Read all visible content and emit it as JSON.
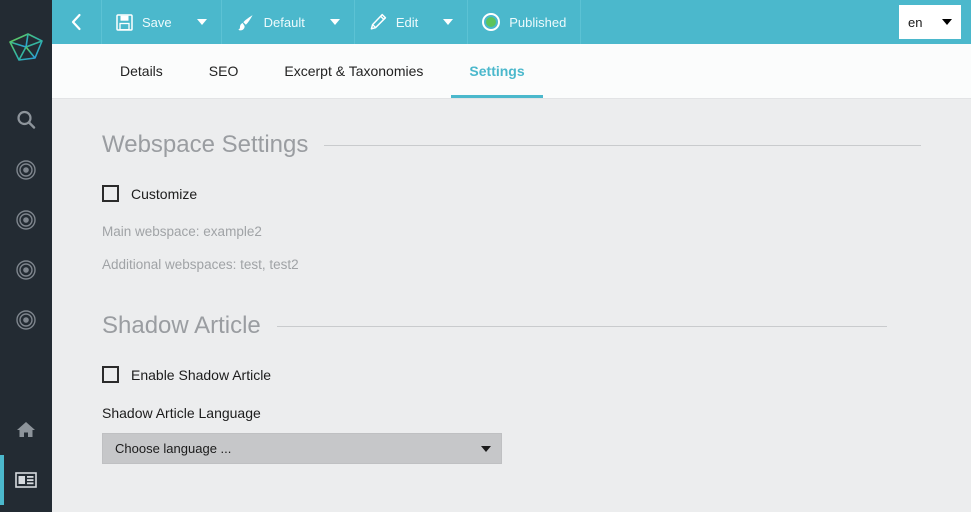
{
  "sidebar": {
    "logo_name": "gem-logo",
    "items": [
      {
        "name": "search-icon",
        "icon": "search",
        "active": false
      },
      {
        "name": "target-icon-1",
        "icon": "target",
        "active": false
      },
      {
        "name": "target-icon-2",
        "icon": "target",
        "active": false
      },
      {
        "name": "target-icon-3",
        "icon": "target",
        "active": false
      },
      {
        "name": "target-icon-4",
        "icon": "target",
        "active": false
      },
      {
        "name": "home-icon",
        "icon": "home",
        "active": false
      },
      {
        "name": "newspaper-icon",
        "icon": "newspaper",
        "active": true
      }
    ]
  },
  "toolbar": {
    "back_label": "",
    "back_icon": "chevron-left-icon",
    "save_label": "Save",
    "save_icon": "floppy-disk-icon",
    "default_label": "Default",
    "default_icon": "paintbrush-icon",
    "edit_label": "Edit",
    "edit_icon": "pencil-icon",
    "status_label": "Published",
    "status_icon": "status-dot-icon",
    "status_color": "#5CC45C",
    "language_value": "en",
    "accent_color": "#4BB8CC"
  },
  "tabs": [
    {
      "label": "Details",
      "active": false
    },
    {
      "label": "SEO",
      "active": false
    },
    {
      "label": "Excerpt & Taxonomies",
      "active": false
    },
    {
      "label": "Settings",
      "active": true
    }
  ],
  "main": {
    "webspace_section": {
      "title": "Webspace Settings",
      "customize_label": "Customize",
      "customize_checked": false,
      "main_webspace": "Main webspace: example2",
      "additional_webspaces": "Additional webspaces: test, test2"
    },
    "shadow_section": {
      "title": "Shadow Article",
      "enable_label": "Enable Shadow Article",
      "enable_checked": false,
      "language_label": "Shadow Article Language",
      "language_value": "Choose language ..."
    }
  }
}
